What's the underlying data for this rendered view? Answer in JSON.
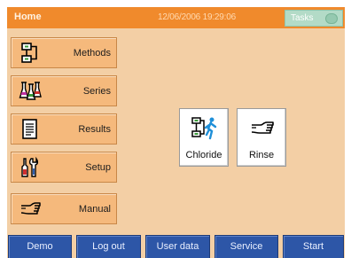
{
  "header": {
    "title": "Home",
    "datetime": "12/06/2006 19:29:06",
    "tasks_label": "Tasks"
  },
  "menu": [
    {
      "label": "Methods",
      "icon": "method-flowchart-icon"
    },
    {
      "label": "Series",
      "icon": "flasks-icon"
    },
    {
      "label": "Results",
      "icon": "document-icon"
    },
    {
      "label": "Setup",
      "icon": "tools-icon"
    },
    {
      "label": "Manual",
      "icon": "hand-pointing-icon"
    }
  ],
  "tasks": [
    {
      "label": "Chloride",
      "icon": "method-run-icon"
    },
    {
      "label": "Rinse",
      "icon": "hand-pointing-icon"
    }
  ],
  "footer": [
    "Demo",
    "Log out",
    "User data",
    "Service",
    "Start"
  ],
  "colors": {
    "header_bg": "#f08a2c",
    "screen_bg": "#f3cfa5",
    "menu_button": "#f5b97c",
    "footer_button": "#2d56a7",
    "tasks_bg": "#b3dbc7"
  }
}
